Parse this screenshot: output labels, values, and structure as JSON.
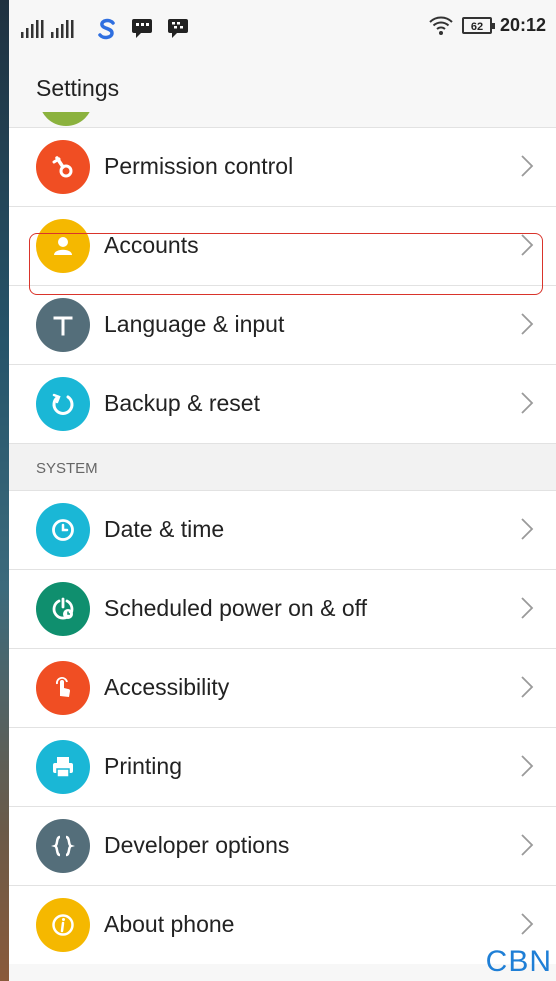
{
  "status_bar": {
    "time": "20:12",
    "battery": "62",
    "icons": [
      "signal-icon",
      "signal-icon",
      "s-app-icon",
      "chat-icon",
      "message-icon",
      "wifi-icon",
      "battery-icon"
    ]
  },
  "header": {
    "title": "Settings"
  },
  "rows_top": [
    {
      "label": "Permission control",
      "icon": "wrench-icon",
      "color": "#f04e23"
    },
    {
      "label": "Accounts",
      "icon": "user-icon",
      "color": "#f5b800",
      "highlighted": true
    },
    {
      "label": "Language & input",
      "icon": "t-icon",
      "color": "#546e7a"
    },
    {
      "label": "Backup & reset",
      "icon": "restore-icon",
      "color": "#1ab7d6"
    }
  ],
  "section": {
    "label": "SYSTEM"
  },
  "rows_system": [
    {
      "label": "Date & time",
      "icon": "clock-icon",
      "color": "#1ab7d6"
    },
    {
      "label": "Scheduled power on & off",
      "icon": "power-clock-icon",
      "color": "#0f8f6e"
    },
    {
      "label": "Accessibility",
      "icon": "hand-icon",
      "color": "#f04e23"
    },
    {
      "label": "Printing",
      "icon": "printer-icon",
      "color": "#1ab7d6"
    },
    {
      "label": "Developer options",
      "icon": "braces-icon",
      "color": "#546e7a"
    },
    {
      "label": "About phone",
      "icon": "info-icon",
      "color": "#f5b800"
    }
  ],
  "watermark": "CBN"
}
